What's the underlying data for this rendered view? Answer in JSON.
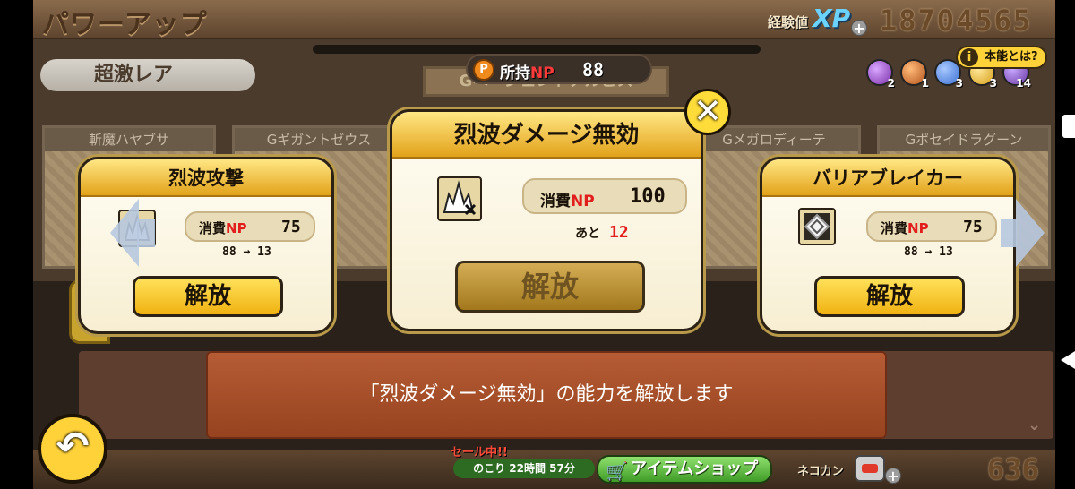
{
  "header": {
    "title": "パワーアップ",
    "xp_label": "経験値",
    "xp_badge": "XP",
    "xp_plus": "+",
    "xp_value": "18704565"
  },
  "background": {
    "rarity_tab": "超激レア",
    "faded_title": "Gベージェントアルビス",
    "cards": [
      {
        "name": "斬魔ハヤブサ"
      },
      {
        "name": "Gギガントゼウス"
      },
      {
        "name": "Gメガロディーテ"
      },
      {
        "name": "Gポセイドラグーン"
      }
    ]
  },
  "np_bar": {
    "coin": "P",
    "label_prefix": "所持",
    "label_np": "NP",
    "value": "88"
  },
  "orbs": [
    {
      "count": "2",
      "color": "#7a2fa8"
    },
    {
      "count": "1",
      "color": "#b3531c"
    },
    {
      "count": "3",
      "color": "#3a6fd1"
    },
    {
      "count": "3",
      "color": "#d6a01a"
    },
    {
      "count": "14",
      "color": "#6b3aa3"
    }
  ],
  "help_button": {
    "icon": "i",
    "label": "本能とは?"
  },
  "cards": {
    "left": {
      "title": "烈波攻撃",
      "cost_prefix": "消費",
      "cost_np": "NP",
      "cost": "75",
      "level": "88 → 13",
      "button": "解放"
    },
    "center": {
      "title": "烈波ダメージ無効",
      "cost_prefix": "消費",
      "cost_np": "NP",
      "cost": "100",
      "remain_label": "あと",
      "remain_value": "12",
      "button": "解放"
    },
    "right": {
      "title": "バリアブレイカー",
      "cost_prefix": "消費",
      "cost_np": "NP",
      "cost": "75",
      "level": "88 → 13",
      "button": "解放"
    }
  },
  "close_button": "✕",
  "message": "「烈波ダメージ無効」の能力を解放します",
  "footer": {
    "back_glyph": "↶",
    "sale_label": "セール中!!",
    "sale_time": "のこり 22時間 57分",
    "shop_label": "アイテムショップ",
    "shop_icon": "🛒",
    "catfood_label": "ネコカン",
    "catfood_plus": "+",
    "catfood_value": "636"
  },
  "colors": {
    "accent_yellow": "#ffd23a",
    "np_red": "#e21d1d",
    "message_bg": "#b55c35"
  }
}
